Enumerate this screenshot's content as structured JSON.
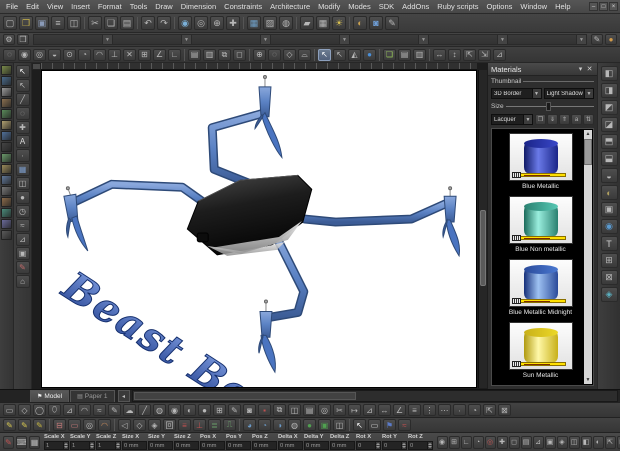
{
  "window": {
    "minimize": "–",
    "maximize": "□",
    "close": "×"
  },
  "menu": {
    "items": [
      "File",
      "Edit",
      "View",
      "Insert",
      "Format",
      "Tools",
      "Draw",
      "Dimension",
      "Constraints",
      "Architecture",
      "Modify",
      "Modes",
      "SDK",
      "AddOns",
      "Ruby scripts",
      "Options",
      "Window",
      "Help"
    ]
  },
  "toolbar_main": {
    "icons": [
      {
        "name": "new-icon",
        "glyph": "▢"
      },
      {
        "name": "open-icon",
        "glyph": "❒",
        "color": "#c8b24a"
      },
      {
        "name": "save-icon",
        "glyph": "▣",
        "color": "#8a9ab8"
      },
      {
        "name": "print-icon",
        "glyph": "≡"
      },
      {
        "name": "print-preview-icon",
        "glyph": "◫"
      },
      {
        "sep": true
      },
      {
        "name": "cut-icon",
        "glyph": "✂"
      },
      {
        "name": "copy-icon",
        "glyph": "❏"
      },
      {
        "name": "paste-icon",
        "glyph": "▤"
      },
      {
        "sep": true
      },
      {
        "name": "undo-icon",
        "glyph": "↶"
      },
      {
        "name": "redo-icon",
        "glyph": "↷"
      },
      {
        "sep": true
      },
      {
        "name": "zoom-window-icon",
        "glyph": "◉",
        "color": "#7ab0d8"
      },
      {
        "name": "zoom-extents-icon",
        "glyph": "◎"
      },
      {
        "name": "zoom-in-icon",
        "glyph": "⊕"
      },
      {
        "name": "pan-icon",
        "glyph": "✚"
      },
      {
        "sep": true
      },
      {
        "name": "render-wireframe-icon",
        "glyph": "▦",
        "color": "#6fa0c8"
      },
      {
        "name": "render-hidden-icon",
        "glyph": "▨"
      },
      {
        "name": "render-quality-icon",
        "glyph": "◍"
      },
      {
        "sep": true
      },
      {
        "name": "workplane-icon",
        "glyph": "▰"
      },
      {
        "name": "grid-icon",
        "glyph": "▦"
      },
      {
        "name": "lights-icon",
        "glyph": "☀",
        "color": "#d8c050"
      },
      {
        "sep": true
      },
      {
        "name": "materials-icon",
        "glyph": "◐",
        "color": "#c8a050"
      },
      {
        "name": "camera-icon",
        "glyph": "◙",
        "color": "#6f9fd8"
      },
      {
        "name": "properties-icon",
        "glyph": "✎"
      }
    ]
  },
  "toolbar_props": {
    "gear_icon": "⚙",
    "style_icon": "❒",
    "pen_icon": "✎",
    "brush_icon": "●",
    "segments": 7
  },
  "toolbar_snap": {
    "icons": [
      {
        "name": "snap-free-icon",
        "glyph": "◌"
      },
      {
        "name": "snap-vertex-icon",
        "glyph": "◉"
      },
      {
        "name": "snap-nearest-icon",
        "glyph": "◎"
      },
      {
        "name": "snap-midpoint-icon",
        "glyph": "◒"
      },
      {
        "name": "snap-center-icon",
        "glyph": "⊙"
      },
      {
        "name": "snap-quadrant-icon",
        "glyph": "◔"
      },
      {
        "name": "snap-tangent-icon",
        "glyph": "◠"
      },
      {
        "name": "snap-perpendicular-icon",
        "glyph": "⊥"
      },
      {
        "name": "snap-intersection-icon",
        "glyph": "✕"
      },
      {
        "name": "snap-grid-icon",
        "glyph": "⊞"
      },
      {
        "name": "snap-angle-icon",
        "glyph": "∠"
      },
      {
        "name": "snap-ortho-icon",
        "glyph": "∟"
      },
      {
        "sep": true
      },
      {
        "name": "layer-icon",
        "glyph": "▤"
      },
      {
        "name": "layer-manager-icon",
        "glyph": "▥"
      },
      {
        "name": "group-icon",
        "glyph": "⧉"
      },
      {
        "name": "lock-icon",
        "glyph": "◻"
      },
      {
        "sep": true
      },
      {
        "name": "coord-world-icon",
        "glyph": "⊕"
      },
      {
        "name": "coord-user-icon",
        "glyph": "◌"
      },
      {
        "name": "view-iso-icon",
        "glyph": "◇"
      },
      {
        "name": "view-top-icon",
        "glyph": "⌓"
      },
      {
        "sep": true
      },
      {
        "name": "select-arrow-icon",
        "glyph": "↖",
        "color": "#ffffff",
        "active": true
      },
      {
        "name": "select-lasso-icon",
        "glyph": "↖"
      },
      {
        "name": "edit-tool-icon",
        "glyph": "◭"
      },
      {
        "name": "paint-drop-icon",
        "glyph": "●",
        "color": "#4a90d9"
      },
      {
        "sep": true
      },
      {
        "name": "copy-format-icon",
        "glyph": "❏",
        "color": "#9acd5a"
      },
      {
        "name": "format-a-icon",
        "glyph": "▤"
      },
      {
        "name": "format-b-icon",
        "glyph": "▥"
      },
      {
        "sep": true
      },
      {
        "name": "dim-a-icon",
        "glyph": "↔"
      },
      {
        "name": "dim-b-icon",
        "glyph": "↕"
      },
      {
        "name": "dim-c-icon",
        "glyph": "⇱"
      },
      {
        "name": "dim-d-icon",
        "glyph": "⇲"
      },
      {
        "name": "dim-e-icon",
        "glyph": "⊿"
      }
    ]
  },
  "left_palette": {
    "swatches": [
      {
        "name": "palette-thumb-1",
        "color": "#7a8a4a"
      },
      {
        "name": "palette-thumb-2",
        "color": "#4a6a8a"
      },
      {
        "name": "palette-thumb-3",
        "color": "#9a9a9a"
      },
      {
        "name": "palette-thumb-4",
        "color": "#8a7050"
      },
      {
        "name": "palette-thumb-5",
        "color": "#5a8a5a"
      },
      {
        "name": "palette-thumb-6",
        "color": "#b0a070"
      },
      {
        "name": "palette-thumb-7",
        "color": "#50709a"
      },
      {
        "name": "palette-thumb-8",
        "color": "#444444"
      },
      {
        "name": "palette-thumb-9",
        "color": "#6a9a6a"
      },
      {
        "name": "palette-thumb-10",
        "color": "#9a8a5a"
      },
      {
        "name": "palette-thumb-11",
        "color": "#607898"
      },
      {
        "name": "palette-thumb-12",
        "color": "#787878"
      },
      {
        "name": "palette-thumb-13",
        "color": "#8a6a4a"
      },
      {
        "name": "palette-thumb-14",
        "color": "#4a8a7a"
      },
      {
        "name": "palette-thumb-15",
        "color": "#6a6a9a"
      },
      {
        "name": "palette-thumb-16",
        "color": "#5a5a5a"
      }
    ]
  },
  "left_tools": {
    "icons": [
      {
        "name": "select-tool-icon",
        "glyph": "↖",
        "color": "#ffffff"
      },
      {
        "name": "select-edit-icon",
        "glyph": "↖"
      },
      {
        "name": "line-tool-icon",
        "glyph": "╱"
      },
      {
        "name": "circle-tool-icon",
        "glyph": "◌"
      },
      {
        "name": "point-tool-icon",
        "glyph": "✚"
      },
      {
        "name": "text-tool-icon",
        "glyph": "A",
        "color": "#d8d8d8"
      },
      {
        "name": "dot-tool-icon",
        "glyph": "∙"
      },
      {
        "name": "hatch-tool-icon",
        "glyph": "▦",
        "color": "#7a9ac8"
      },
      {
        "name": "cylinder-tool-icon",
        "glyph": "◫"
      },
      {
        "name": "sphere-tool-icon",
        "glyph": "●"
      },
      {
        "name": "arc-tool-icon",
        "glyph": "◷"
      },
      {
        "name": "spline-tool-icon",
        "glyph": "≈"
      },
      {
        "name": "polygon-tool-icon",
        "glyph": "⊿"
      },
      {
        "name": "box-tool-icon",
        "glyph": "▣"
      },
      {
        "name": "pen-tool-icon",
        "glyph": "✎",
        "color": "#c06a6a"
      },
      {
        "name": "dimension-tool-icon",
        "glyph": "⌂"
      }
    ]
  },
  "right_tools": {
    "icons": [
      {
        "name": "extrude-icon",
        "glyph": "◧"
      },
      {
        "name": "revolve-icon",
        "glyph": "◨"
      },
      {
        "name": "sweep-icon",
        "glyph": "◩"
      },
      {
        "name": "loft-icon",
        "glyph": "◪"
      },
      {
        "name": "shell-icon",
        "glyph": "⬒"
      },
      {
        "name": "boolean-icon",
        "glyph": "⬓"
      },
      {
        "name": "fillet-icon",
        "glyph": "◒"
      },
      {
        "name": "material-ball-icon",
        "glyph": "◐",
        "color": "#b0a060"
      },
      {
        "name": "facet-icon",
        "glyph": "▣"
      },
      {
        "name": "smooth-icon",
        "glyph": "◉",
        "color": "#5a9ad0"
      },
      {
        "name": "text3d-icon",
        "glyph": "T",
        "color": "#d0d0d0"
      },
      {
        "name": "mesh-icon",
        "glyph": "⊞"
      },
      {
        "name": "slice-icon",
        "glyph": "⊠"
      },
      {
        "name": "gem-icon",
        "glyph": "◈",
        "color": "#5ab0c0"
      }
    ]
  },
  "canvas": {
    "model_label": "Beast Bot"
  },
  "materials_panel": {
    "title": "Materials",
    "pin_icon": "▾",
    "close_icon": "✕",
    "thumbnail_label": "Thumbnail",
    "size_label": "Size",
    "border_dropdown": "3D Border",
    "shadow_dropdown": "Light Shadow",
    "category_dropdown": "Lacquer",
    "tool_icons": [
      {
        "name": "open-palette-icon",
        "glyph": "❒"
      },
      {
        "name": "import-material-icon",
        "glyph": "⇓"
      },
      {
        "name": "export-material-icon",
        "glyph": "⇑"
      },
      {
        "name": "rename-material-icon",
        "glyph": "a"
      },
      {
        "name": "sort-material-icon",
        "glyph": "⇅"
      }
    ],
    "scroll_up": "▲",
    "scroll_down": "▼",
    "items": [
      {
        "label": "Blue Metallic",
        "side1": "#101a66",
        "side2": "#6a7ae8",
        "side3": "#1a2488",
        "top": "#3947c8"
      },
      {
        "label": "Blue Non metallic",
        "side1": "#1a6a5a",
        "side2": "#9aeede",
        "side3": "#2a8070",
        "top": "#57c8b4"
      },
      {
        "label": "Blue Metallic Midnight",
        "side1": "#16307a",
        "side2": "#9ec2f2",
        "side3": "#2a4a9a",
        "top": "#4a78d0"
      },
      {
        "label": "Sun Metallic",
        "side1": "#b09a10",
        "side2": "#fff8a8",
        "side3": "#c8b018",
        "top": "#ecd828"
      }
    ]
  },
  "tabs": {
    "model": {
      "label": "Model",
      "icon": "⚑"
    },
    "paper": {
      "label": "Paper 1",
      "icon": "▤"
    },
    "nav_left": "◂"
  },
  "toolbar_draw": {
    "icons": [
      {
        "name": "rect-tool-icon",
        "glyph": "▭"
      },
      {
        "name": "rotated-rect-icon",
        "glyph": "◇"
      },
      {
        "name": "circle-icon",
        "glyph": "◯"
      },
      {
        "name": "ellipse-icon",
        "glyph": "⬯"
      },
      {
        "name": "polygon-icon",
        "glyph": "⊿"
      },
      {
        "name": "arc-icon",
        "glyph": "◠"
      },
      {
        "name": "curve-icon",
        "glyph": "≈"
      },
      {
        "name": "sketch-icon",
        "glyph": "✎"
      },
      {
        "name": "cloud-icon",
        "glyph": "☁"
      },
      {
        "name": "ray-icon",
        "glyph": "╱"
      },
      {
        "name": "spray-icon",
        "glyph": "◍"
      },
      {
        "name": "stamp-icon",
        "glyph": "◉"
      },
      {
        "name": "orbit-icon",
        "glyph": "◐"
      },
      {
        "name": "sphere-icon",
        "glyph": "●"
      },
      {
        "name": "grid2-icon",
        "glyph": "⊞"
      },
      {
        "name": "pencil2-icon",
        "glyph": "✎"
      },
      {
        "name": "lamp-icon",
        "glyph": "◙"
      },
      {
        "name": "marker-red-icon",
        "glyph": "▪",
        "color": "#c05050"
      },
      {
        "name": "modify-icon",
        "glyph": "⧉"
      },
      {
        "name": "mirror-icon",
        "glyph": "◫"
      },
      {
        "name": "array-icon",
        "glyph": "▤"
      },
      {
        "name": "offset-icon",
        "glyph": "◎"
      },
      {
        "name": "trim-icon",
        "glyph": "✂"
      },
      {
        "name": "extend-icon",
        "glyph": "↦"
      },
      {
        "name": "chamfer-icon",
        "glyph": "⊿"
      },
      {
        "name": "measure-icon",
        "glyph": "↔"
      },
      {
        "name": "protractor-icon",
        "glyph": "∠"
      },
      {
        "name": "ruler-icon",
        "glyph": "≡"
      },
      {
        "name": "align-icon",
        "glyph": "⋮"
      },
      {
        "name": "distribute-icon",
        "glyph": "⋯"
      },
      {
        "name": "node-icon",
        "glyph": "∙"
      },
      {
        "name": "magnet2-icon",
        "glyph": "◔"
      },
      {
        "name": "transform-icon",
        "glyph": "⇱"
      },
      {
        "name": "scale-tool-icon",
        "glyph": "⊠"
      }
    ]
  },
  "toolbar_modify": {
    "icons": [
      {
        "name": "pencil-yellow-icon",
        "glyph": "✎",
        "color": "#d8c850"
      },
      {
        "name": "pencil-yellow2-icon",
        "glyph": "✎",
        "color": "#d8c850"
      },
      {
        "name": "pencil-yellow3-icon",
        "glyph": "✎",
        "color": "#c8b840"
      },
      {
        "sep": true
      },
      {
        "name": "node-edit-icon",
        "glyph": "⊟",
        "color": "#c87a7a"
      },
      {
        "name": "shape-edit-icon",
        "glyph": "▭",
        "color": "#c87a7a"
      },
      {
        "name": "weld-icon",
        "glyph": "◎"
      },
      {
        "name": "bend-icon",
        "glyph": "◠",
        "color": "#c88a5a"
      },
      {
        "sep": true
      },
      {
        "name": "mirror2-icon",
        "glyph": "◁"
      },
      {
        "name": "rotate2-icon",
        "glyph": "◇"
      },
      {
        "name": "facet2-icon",
        "glyph": "◈"
      },
      {
        "name": "frame-icon",
        "glyph": "回"
      },
      {
        "name": "beam-icon",
        "glyph": "≡",
        "color": "#c05050"
      },
      {
        "name": "column-icon",
        "glyph": "⊥",
        "color": "#c05050"
      },
      {
        "name": "stair-icon",
        "glyph": "≣",
        "color": "#6aa06a"
      },
      {
        "name": "door-icon",
        "glyph": "⎍",
        "color": "#6aa06a"
      },
      {
        "sep": true
      },
      {
        "name": "boolean-add-icon",
        "glyph": "◕",
        "color": "#6a9ac8"
      },
      {
        "name": "boolean-sub-icon",
        "glyph": "◔",
        "color": "#6a9ac8"
      },
      {
        "name": "boolean-int-icon",
        "glyph": "◑",
        "color": "#6a9ac8"
      },
      {
        "name": "slice2-icon",
        "glyph": "◍"
      },
      {
        "name": "sphere-green-icon",
        "glyph": "●",
        "color": "#50a050"
      },
      {
        "name": "cube-green-icon",
        "glyph": "▣",
        "color": "#50a050"
      },
      {
        "name": "blend-icon",
        "glyph": "◫"
      },
      {
        "sep": true
      },
      {
        "name": "cursor2-icon",
        "glyph": "↖",
        "color": "#ffffff"
      },
      {
        "name": "window-icon",
        "glyph": "▭",
        "color": "#d0d0d0"
      },
      {
        "name": "flag-icon",
        "glyph": "⚑",
        "color": "#5a7ac8"
      },
      {
        "name": "wave-icon",
        "glyph": "≈",
        "color": "#c05050"
      }
    ]
  },
  "statusbar": {
    "left_icons": [
      {
        "name": "no-draw-icon",
        "glyph": "✎",
        "color": "#c05050"
      },
      {
        "name": "keyboard-entry-icon",
        "glyph": "⌨"
      },
      {
        "name": "coord-display-icon",
        "glyph": "▦"
      }
    ],
    "fields": [
      {
        "label": "Scale X",
        "value": "1",
        "spin": true
      },
      {
        "label": "Scale Y",
        "value": "1",
        "spin": true
      },
      {
        "label": "Scale Z",
        "value": "1",
        "spin": true
      },
      {
        "label": "Size X",
        "value": "0 mm"
      },
      {
        "label": "Size Y",
        "value": "0 mm"
      },
      {
        "label": "Size Z",
        "value": "0 mm"
      },
      {
        "label": "Pos X",
        "value": "0 mm"
      },
      {
        "label": "Pos Y",
        "value": "0 mm"
      },
      {
        "label": "Pos Z",
        "value": "0 mm"
      },
      {
        "label": "Delta X",
        "value": "0 mm"
      },
      {
        "label": "Delta Y",
        "value": "0 mm"
      },
      {
        "label": "Delta Z",
        "value": "0 mm"
      },
      {
        "label": "Rot X",
        "value": "0",
        "spin": true
      },
      {
        "label": "Rot Y",
        "value": "0",
        "spin": true
      },
      {
        "label": "Rot Z",
        "value": "0",
        "spin": true
      }
    ],
    "right_icons": [
      {
        "name": "snap-toggle-icon",
        "glyph": "◉"
      },
      {
        "name": "grid-toggle-icon",
        "glyph": "⊞"
      },
      {
        "name": "ortho-toggle-icon",
        "glyph": "∟"
      },
      {
        "name": "polar-toggle-icon",
        "glyph": "◔"
      },
      {
        "name": "osnap-toggle-icon",
        "glyph": "◎",
        "color": "#c05050"
      },
      {
        "name": "track-toggle-icon",
        "glyph": "✚"
      },
      {
        "name": "lock-toggle-icon",
        "glyph": "◻"
      },
      {
        "name": "layer-toggle-icon",
        "glyph": "▤"
      },
      {
        "name": "ucs-toggle-icon",
        "glyph": "⊿"
      },
      {
        "name": "model-toggle-icon",
        "glyph": "▣"
      },
      {
        "name": "annot-toggle-icon",
        "glyph": "◈"
      },
      {
        "name": "scale-ind-icon",
        "glyph": "◫"
      },
      {
        "name": "view-cube-icon",
        "glyph": "◧"
      },
      {
        "name": "steering-icon",
        "glyph": "◐"
      },
      {
        "name": "fullscreen-icon",
        "glyph": "⇱"
      },
      {
        "name": "expand-icon",
        "glyph": "⊠"
      }
    ]
  }
}
